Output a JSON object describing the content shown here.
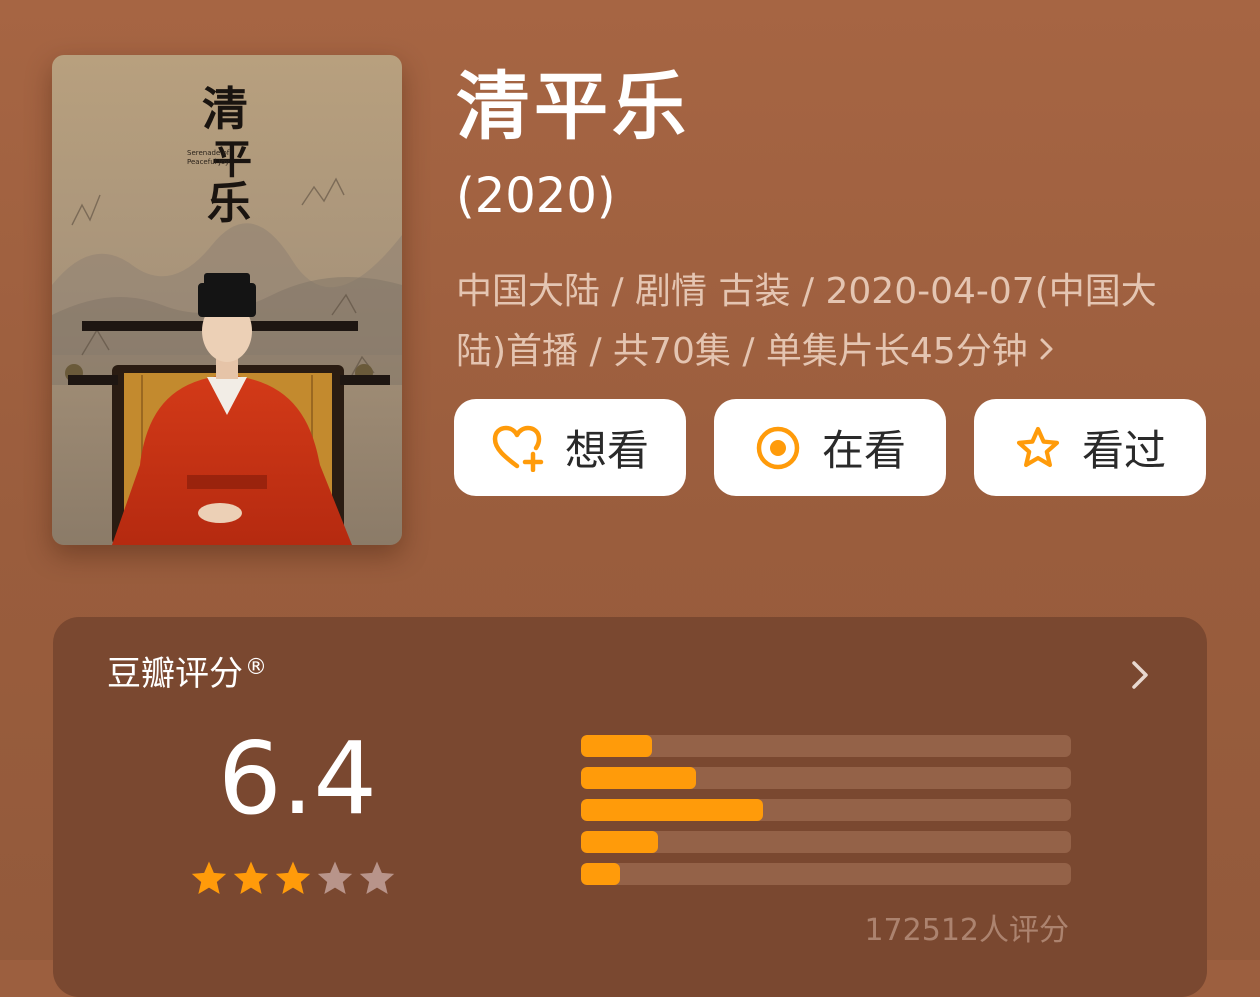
{
  "title": "清平乐",
  "year": "(2020)",
  "meta_text": "中国大陆 / 剧情 古装 / 2020-04-07(中国大陆)首播 / 共70集 / 单集片长45分钟",
  "poster": {
    "calligraphy": "清平乐",
    "subtitle_line1": "Serenade of",
    "subtitle_line2": "Peaceful Joy"
  },
  "actions": [
    {
      "label": "想看",
      "icon": "heart-plus-icon"
    },
    {
      "label": "在看",
      "icon": "target-circle-icon"
    },
    {
      "label": "看过",
      "icon": "star-outline-icon"
    }
  ],
  "rating": {
    "heading": "豆瓣评分",
    "registered_mark": "®",
    "score": "6.4",
    "score_stars": 3,
    "distribution": [
      {
        "stars": 5,
        "fraction": 0.145
      },
      {
        "stars": 4,
        "fraction": 0.235
      },
      {
        "stars": 3,
        "fraction": 0.372
      },
      {
        "stars": 2,
        "fraction": 0.158
      },
      {
        "stars": 1,
        "fraction": 0.08
      }
    ],
    "count_text": "172512人评分"
  },
  "colors": {
    "accent": "#ff9b0a",
    "star_empty": "#b8948a",
    "background": "#9c5f3f",
    "card": "#7a4830"
  }
}
